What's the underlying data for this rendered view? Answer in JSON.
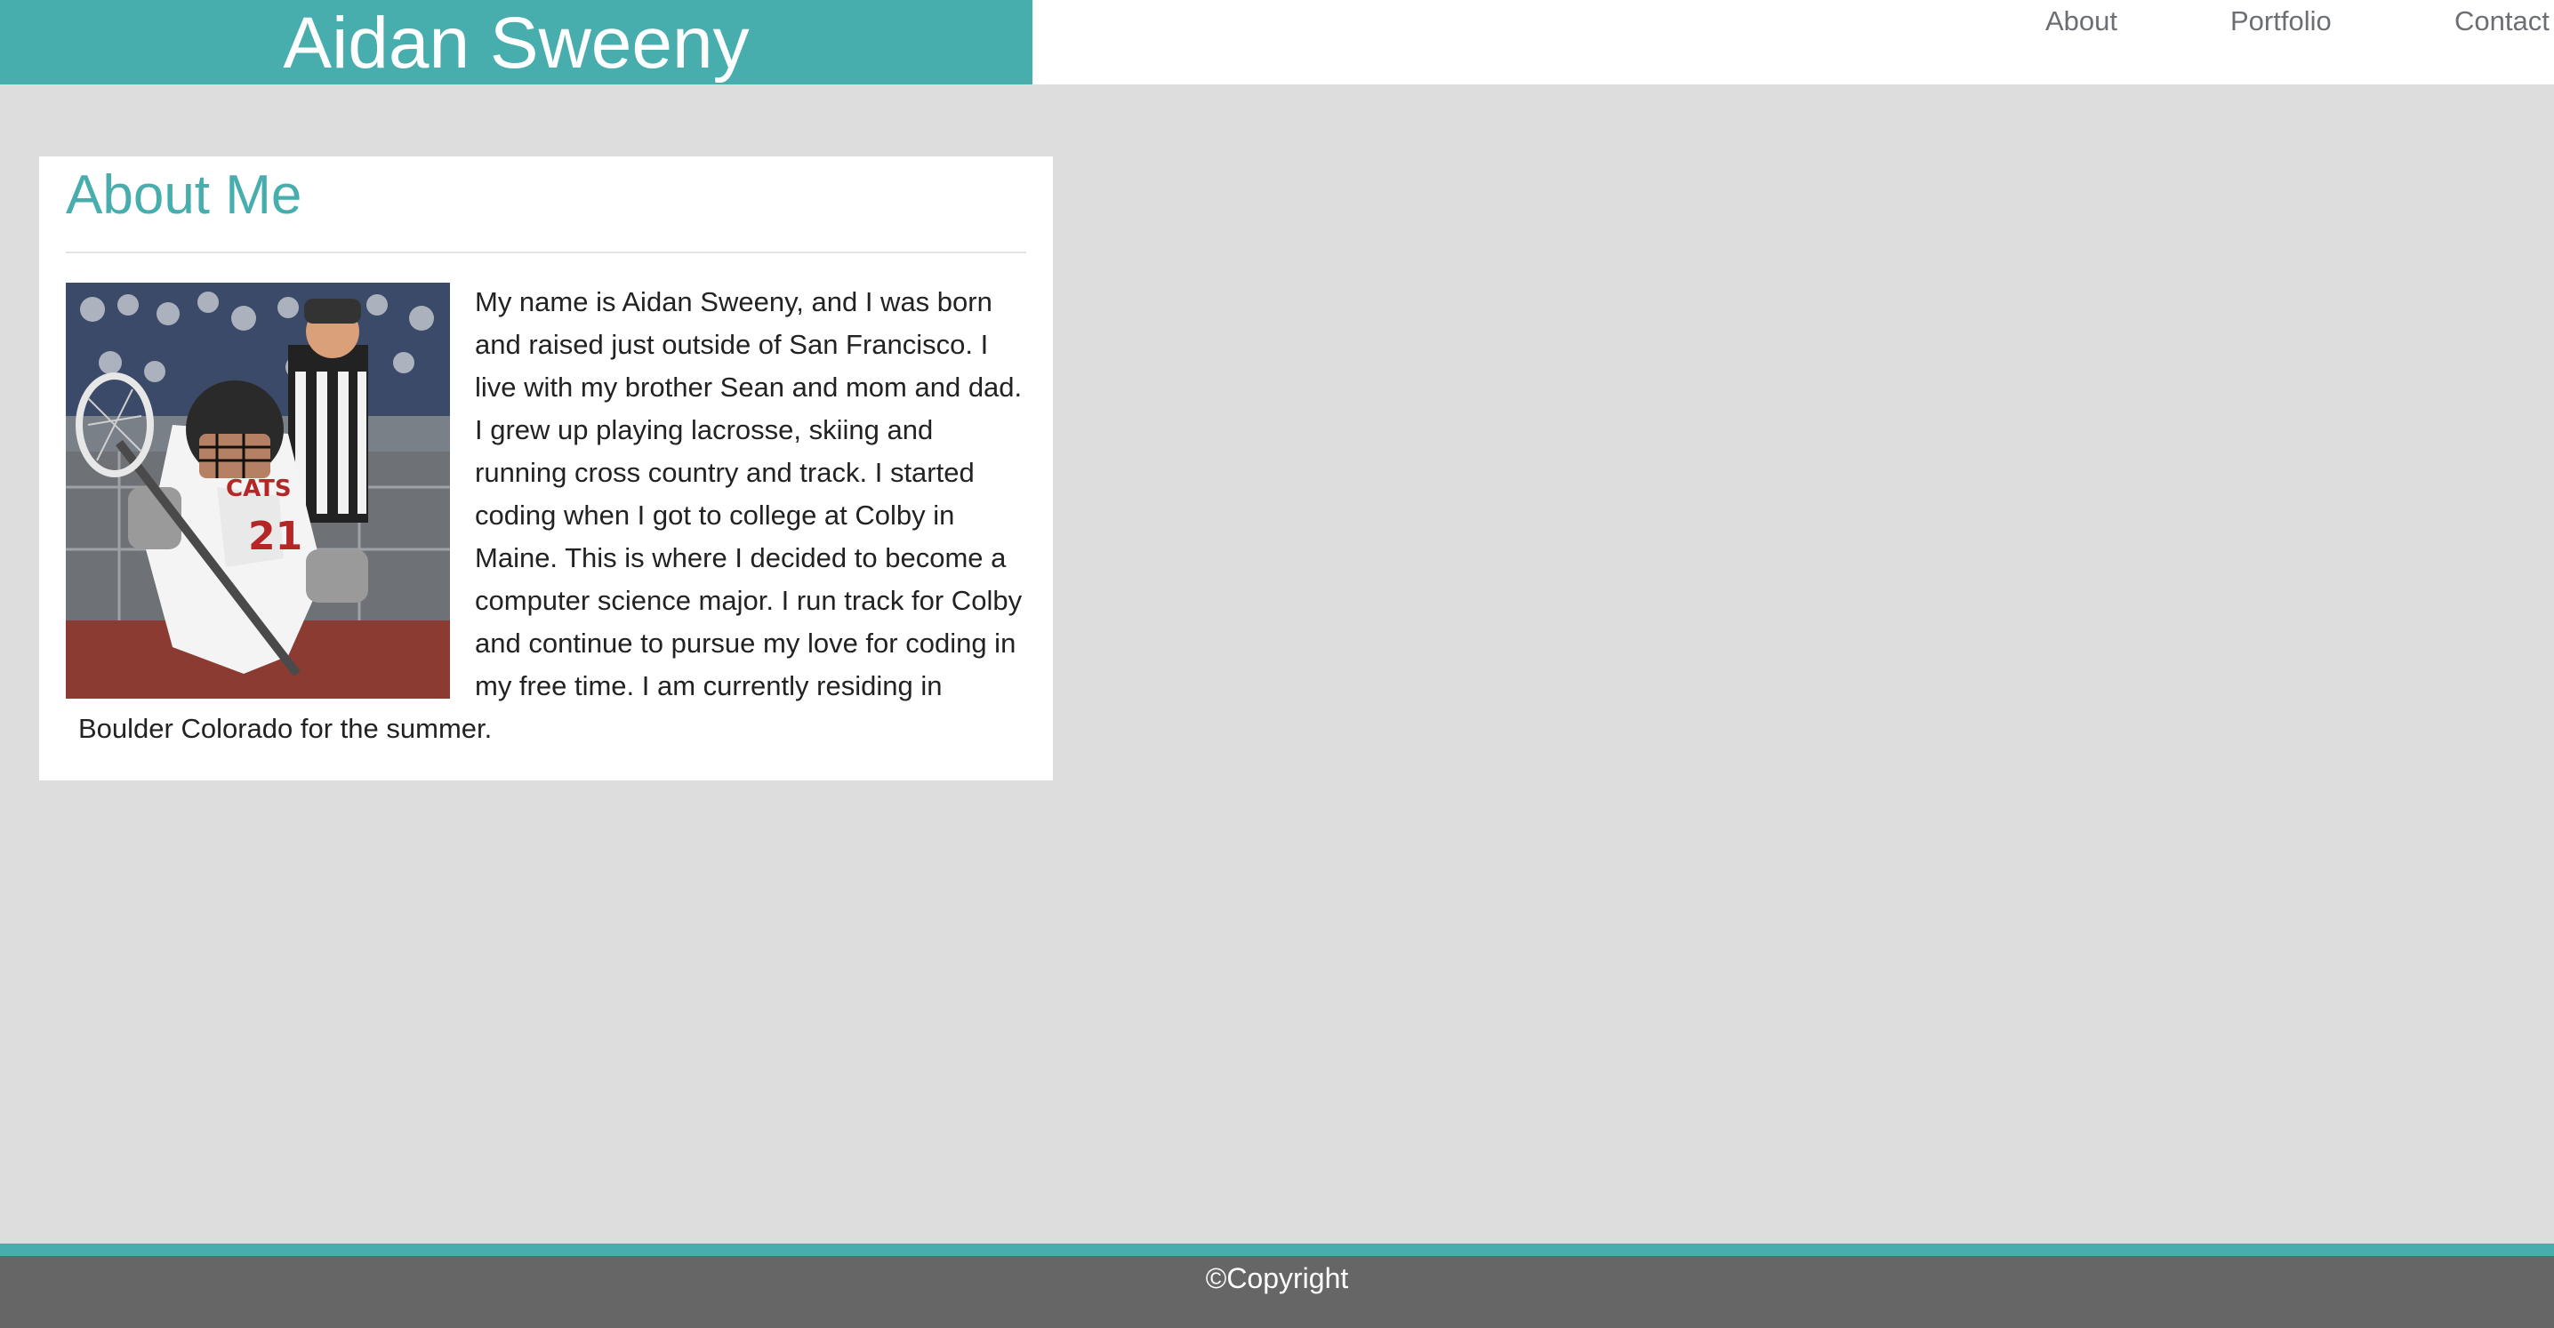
{
  "header": {
    "brand": "Aidan Sweeny",
    "nav": [
      {
        "label": "About"
      },
      {
        "label": "Portfolio"
      },
      {
        "label": "Contact"
      }
    ]
  },
  "about": {
    "title": "About Me",
    "photo_alt": "lacrosse player photo",
    "bio": "My name is Aidan Sweeny, and I was born and raised just outside of San Francisco. I live with my brother Sean and mom and dad. I grew up playing lacrosse, skiing and running cross country and track. I started coding when I got to college at Colby in Maine. This is where I decided to become a computer science major. I run track for Colby and continue to pursue my love for coding in my free time. I am currently residing in Boulder Colorado for the summer."
  },
  "footer": {
    "copyright": "©Copyright"
  },
  "colors": {
    "accent": "#47adad",
    "background": "#dddddd",
    "footer": "#666666",
    "nav_text": "#6b6f73"
  }
}
